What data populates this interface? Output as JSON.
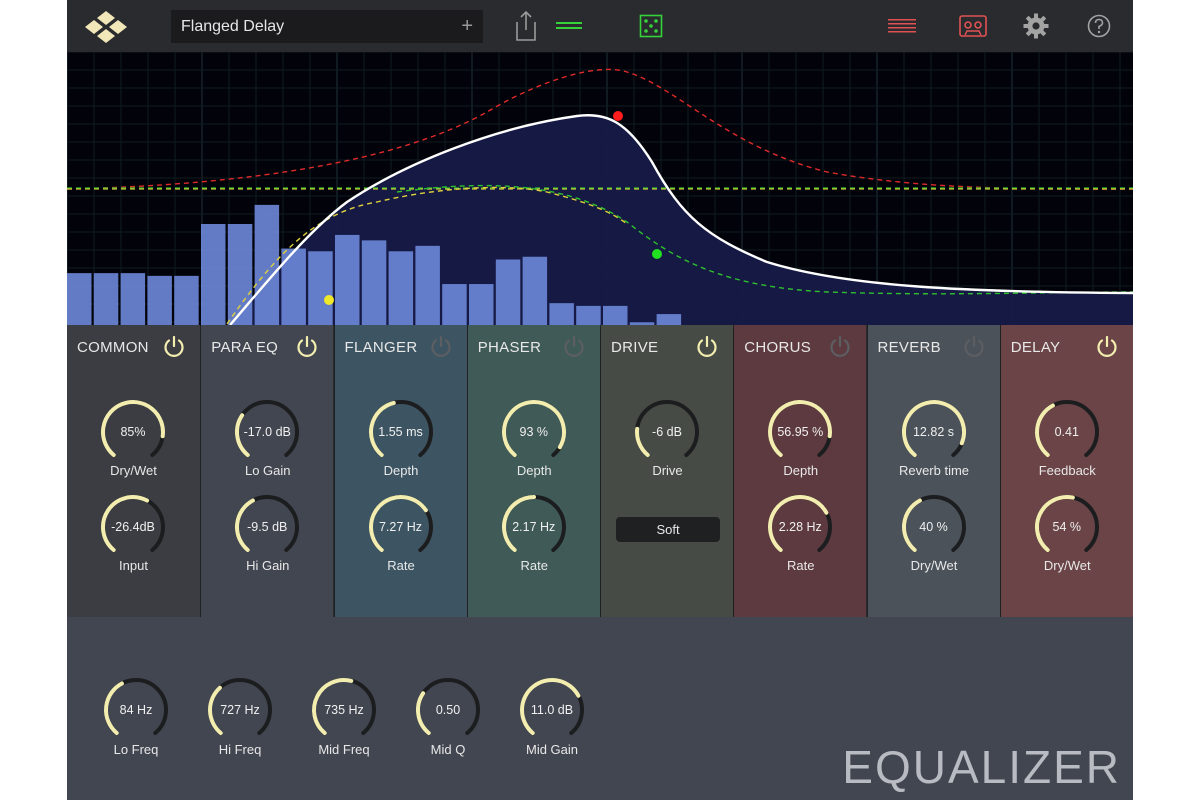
{
  "topbar": {
    "preset_name": "Flanged Delay",
    "preset_add": "+",
    "icons": [
      "logo-icon",
      "share-icon",
      "meter-icon",
      "dice-icon",
      "list-icon",
      "cassette-icon",
      "gear-icon",
      "help-icon"
    ]
  },
  "graph": {
    "spectrum_bars": [
      0.19,
      0.19,
      0.19,
      0.18,
      0.18,
      0.37,
      0.37,
      0.44,
      0.28,
      0.27,
      0.33,
      0.31,
      0.27,
      0.29,
      0.15,
      0.15,
      0.24,
      0.25,
      0.08,
      0.07,
      0.07,
      0.01,
      0.04
    ],
    "colors": {
      "bars": "#6b86d6",
      "curve": "#ffffff",
      "red": "#e02a2a",
      "green": "#2ec02e",
      "yellow": "#e0d23c",
      "fill": "#161a47"
    }
  },
  "panels": [
    {
      "title": "COMMON",
      "power_on": true,
      "bg": "#3c3d42",
      "knobs": [
        {
          "value": "85%",
          "label": "Dry/Wet",
          "level": 0.85
        },
        {
          "value": "-26.4dB",
          "label": "Input",
          "level": 0.6
        }
      ]
    },
    {
      "title": "PARA EQ",
      "power_on": true,
      "bg": "#424650",
      "knobs": [
        {
          "value": "-17.0 dB",
          "label": "Lo Gain",
          "level": 0.3
        },
        {
          "value": "-9.5 dB",
          "label": "Hi Gain",
          "level": 0.4
        }
      ]
    },
    {
      "title": "FLANGER",
      "power_on": false,
      "bg": "#3d5563",
      "knobs": [
        {
          "value": "1.55  ms",
          "label": "Depth",
          "level": 0.45
        },
        {
          "value": "7.27  Hz",
          "label": "Rate",
          "level": 0.7
        }
      ]
    },
    {
      "title": "PHASER",
      "power_on": false,
      "bg": "#3f5a57",
      "knobs": [
        {
          "value": "93 %",
          "label": "Depth",
          "level": 0.93
        },
        {
          "value": "2.17 Hz",
          "label": "Rate",
          "level": 0.5
        }
      ]
    },
    {
      "title": "DRIVE",
      "power_on": true,
      "bg": "#464c45",
      "knobs": [
        {
          "value": "-6 dB",
          "label": "Drive",
          "level": 0.2
        }
      ],
      "mode": "Soft"
    },
    {
      "title": "CHORUS",
      "power_on": false,
      "bg": "#5d3a3f",
      "knobs": [
        {
          "value": "56.95 %",
          "label": "Depth",
          "level": 0.85
        },
        {
          "value": "2.28  Hz",
          "label": "Rate",
          "level": 0.72
        }
      ]
    },
    {
      "title": "REVERB",
      "power_on": false,
      "bg": "#4b5259",
      "knobs": [
        {
          "value": "12.82 s",
          "label": "Reverb time",
          "level": 0.9
        },
        {
          "value": "40 %",
          "label": "Dry/Wet",
          "level": 0.4
        }
      ]
    },
    {
      "title": "DELAY",
      "power_on": true,
      "bg": "#6a4446",
      "knobs": [
        {
          "value": "0.41",
          "label": "Feedback",
          "level": 0.4
        },
        {
          "value": "54  %",
          "label": "Dry/Wet",
          "level": 0.54
        }
      ]
    }
  ],
  "equalizer": {
    "title": "EQUALIZER",
    "knobs": [
      {
        "value": "84 Hz",
        "label": "Lo Freq",
        "level": 0.4
      },
      {
        "value": "727 Hz",
        "label": "Hi Freq",
        "level": 0.35
      },
      {
        "value": "735 Hz",
        "label": "Mid Freq",
        "level": 0.55
      },
      {
        "value": "0.50",
        "label": "Mid Q",
        "level": 0.3
      },
      {
        "value": "11.0 dB",
        "label": "Mid Gain",
        "level": 0.72
      }
    ]
  },
  "colors": {
    "knob_active": "#f3eeb0",
    "knob_track": "#1c1d1f",
    "power_on": "#f3eeb0",
    "power_off": "#5c5e62"
  }
}
